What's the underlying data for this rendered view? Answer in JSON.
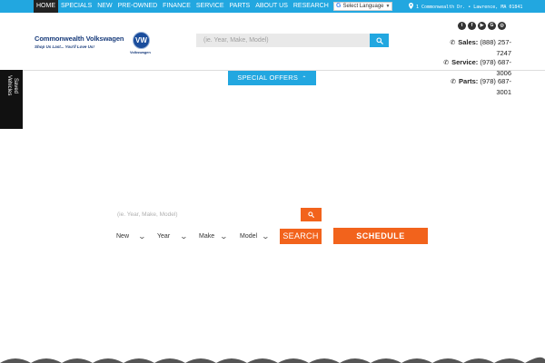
{
  "colors": {
    "accent_blue": "#22a7e0",
    "accent_orange": "#f2631c",
    "brand_navy": "#1a3d7c",
    "nav_active": "#222222"
  },
  "nav": {
    "items": [
      {
        "label": "HOME",
        "active": true
      },
      {
        "label": "SPECIALS"
      },
      {
        "label": "NEW"
      },
      {
        "label": "PRE-OWNED"
      },
      {
        "label": "FINANCE"
      },
      {
        "label": "SERVICE"
      },
      {
        "label": "PARTS"
      },
      {
        "label": "ABOUT US"
      },
      {
        "label": "RESEARCH"
      }
    ],
    "language": {
      "label": "Select Language",
      "icon": "google-g-icon",
      "arrow": "▼"
    },
    "address": "1 Commonwealth Dr. • Lawrence, MA 01841"
  },
  "header": {
    "logo_name": "Commonwealth Volkswagen",
    "logo_tagline": "Shop Us Last... You'll Love Us!",
    "vw_badge": "VW",
    "vw_label": "Volkswagen",
    "search_placeholder": "(ie. Year, Make, Model)",
    "socials": [
      {
        "icon": "twitter-icon",
        "glyph": "t"
      },
      {
        "icon": "facebook-icon",
        "glyph": "f"
      },
      {
        "icon": "youtube-icon",
        "glyph": "▶"
      },
      {
        "icon": "google-plus-icon",
        "glyph": "G"
      },
      {
        "icon": "instagram-icon",
        "glyph": "◎"
      }
    ],
    "phones": [
      {
        "label": "Sales:",
        "line1": "(888) 257-",
        "line2": "7247"
      },
      {
        "label": "Service:",
        "line1": "(978) 687-",
        "line2": "3006"
      },
      {
        "label": "Parts:",
        "line1": "(978) 687-",
        "line2": "3001"
      }
    ]
  },
  "special_offers": {
    "label": "SPECIAL OFFERS",
    "caret": "⌃"
  },
  "saved_vehicles": {
    "label": "Saved\nVehicles"
  },
  "quick_search": {
    "placeholder": "(ie. Year, Make, Model)",
    "filters": [
      "New",
      "Year",
      "Make",
      "Model"
    ],
    "search_label": "SEARCH",
    "schedule_label": "SCHEDULE"
  }
}
